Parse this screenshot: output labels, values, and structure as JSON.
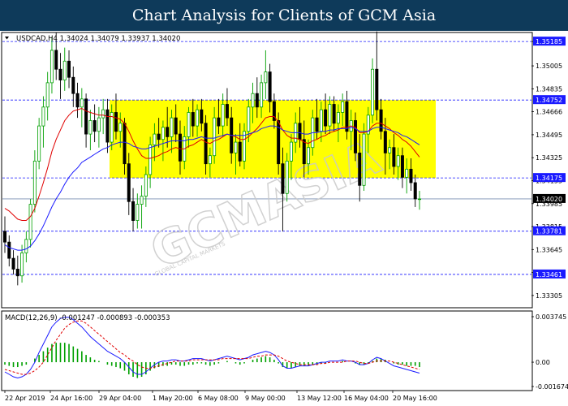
{
  "header": {
    "title": "Chart Analysis for Clients of GCM Asia"
  },
  "chart_data": {
    "type": "candlestick",
    "symbol_line": "USDCAD,H4  1.34024 1.34079 1.33937 1.34020",
    "price_ticks": [
      "1.35185",
      "1.35005",
      "1.34835",
      "1.34666",
      "1.34495",
      "1.34325",
      "1.34155",
      "1.33985",
      "1.33815",
      "1.33645",
      "1.33475",
      "1.33305"
    ],
    "marked_levels": [
      {
        "label": "1.35185",
        "value": 1.35185
      },
      {
        "label": "1.34752",
        "value": 1.34752
      },
      {
        "label": "1.34175",
        "value": 1.34175
      },
      {
        "label": "1.34020",
        "value": 1.3402
      },
      {
        "label": "1.33781",
        "value": 1.33781
      },
      {
        "label": "1.33461",
        "value": 1.33461
      }
    ],
    "range_box": {
      "top": 1.34752,
      "bottom": 1.34175,
      "color": "#ffff00"
    },
    "x_labels": [
      "22 Apr 2019",
      "24 Apr 16:00",
      "29 Apr 04:00",
      "1 May 20:00",
      "6 May 08:00",
      "9 May 00:00",
      "13 May 12:00",
      "16 May 04:00",
      "20 May 16:00"
    ],
    "candles": [
      [
        1.3378,
        1.3389,
        1.3362,
        1.337
      ],
      [
        1.337,
        1.3375,
        1.3352,
        1.3358
      ],
      [
        1.3358,
        1.3364,
        1.3346,
        1.335
      ],
      [
        1.335,
        1.336,
        1.3338,
        1.3345
      ],
      [
        1.3345,
        1.3368,
        1.334,
        1.3362
      ],
      [
        1.3362,
        1.3378,
        1.3355,
        1.3372
      ],
      [
        1.3372,
        1.3402,
        1.3366,
        1.3398
      ],
      [
        1.3398,
        1.3438,
        1.3392,
        1.343
      ],
      [
        1.343,
        1.3462,
        1.3424,
        1.3456
      ],
      [
        1.3456,
        1.3478,
        1.344,
        1.347
      ],
      [
        1.347,
        1.3496,
        1.346,
        1.3488
      ],
      [
        1.3488,
        1.3522,
        1.348,
        1.3512
      ],
      [
        1.3512,
        1.3525,
        1.349,
        1.3498
      ],
      [
        1.3498,
        1.351,
        1.3476,
        1.349
      ],
      [
        1.349,
        1.3514,
        1.3482,
        1.3504
      ],
      [
        1.3504,
        1.3512,
        1.3484,
        1.3492
      ],
      [
        1.3492,
        1.35,
        1.347,
        1.348
      ],
      [
        1.348,
        1.3488,
        1.3462,
        1.347
      ],
      [
        1.347,
        1.3484,
        1.3455,
        1.3476
      ],
      [
        1.3476,
        1.348,
        1.344,
        1.345
      ],
      [
        1.345,
        1.3468,
        1.3438,
        1.346
      ],
      [
        1.346,
        1.3472,
        1.3444,
        1.3452
      ],
      [
        1.3452,
        1.347,
        1.344,
        1.3462
      ],
      [
        1.3462,
        1.3476,
        1.345,
        1.3468
      ],
      [
        1.3468,
        1.3476,
        1.3436,
        1.3444
      ],
      [
        1.3444,
        1.3472,
        1.3438,
        1.3466
      ],
      [
        1.3466,
        1.348,
        1.3446,
        1.3452
      ],
      [
        1.3452,
        1.3466,
        1.344,
        1.3458
      ],
      [
        1.3458,
        1.3462,
        1.342,
        1.3428
      ],
      [
        1.3428,
        1.3436,
        1.339,
        1.34
      ],
      [
        1.34,
        1.341,
        1.3378,
        1.3386
      ],
      [
        1.3386,
        1.3406,
        1.338,
        1.3398
      ],
      [
        1.3398,
        1.3412,
        1.338,
        1.3404
      ],
      [
        1.3404,
        1.3426,
        1.3396,
        1.342
      ],
      [
        1.342,
        1.3448,
        1.341,
        1.3442
      ],
      [
        1.3442,
        1.3458,
        1.343,
        1.345
      ],
      [
        1.345,
        1.3462,
        1.344,
        1.3446
      ],
      [
        1.3446,
        1.346,
        1.343,
        1.3455
      ],
      [
        1.3455,
        1.347,
        1.344,
        1.3448
      ],
      [
        1.3448,
        1.3468,
        1.3436,
        1.3462
      ],
      [
        1.3462,
        1.3472,
        1.3444,
        1.345
      ],
      [
        1.345,
        1.346,
        1.342,
        1.343
      ],
      [
        1.343,
        1.3456,
        1.3424,
        1.3448
      ],
      [
        1.3448,
        1.347,
        1.344,
        1.3466
      ],
      [
        1.3466,
        1.3476,
        1.3448,
        1.3456
      ],
      [
        1.3456,
        1.3472,
        1.3448,
        1.3468
      ],
      [
        1.3468,
        1.3476,
        1.3452,
        1.3458
      ],
      [
        1.3458,
        1.3464,
        1.342,
        1.3428
      ],
      [
        1.3428,
        1.344,
        1.3418,
        1.3434
      ],
      [
        1.3434,
        1.347,
        1.3428,
        1.3462
      ],
      [
        1.3462,
        1.3476,
        1.345,
        1.3456
      ],
      [
        1.3456,
        1.348,
        1.3448,
        1.3472
      ],
      [
        1.3472,
        1.3484,
        1.3456,
        1.3462
      ],
      [
        1.3462,
        1.347,
        1.3428,
        1.3436
      ],
      [
        1.3436,
        1.345,
        1.342,
        1.3444
      ],
      [
        1.3444,
        1.3458,
        1.3426,
        1.343
      ],
      [
        1.343,
        1.3458,
        1.3424,
        1.3452
      ],
      [
        1.3452,
        1.3476,
        1.3444,
        1.347
      ],
      [
        1.347,
        1.3488,
        1.3458,
        1.348
      ],
      [
        1.348,
        1.3492,
        1.3462,
        1.347
      ],
      [
        1.347,
        1.3494,
        1.3462,
        1.3488
      ],
      [
        1.3488,
        1.3512,
        1.3476,
        1.3496
      ],
      [
        1.3496,
        1.3502,
        1.3466,
        1.3474
      ],
      [
        1.3474,
        1.348,
        1.3454,
        1.346
      ],
      [
        1.346,
        1.3466,
        1.342,
        1.3428
      ],
      [
        1.3428,
        1.344,
        1.3378,
        1.3406
      ],
      [
        1.3406,
        1.3436,
        1.34,
        1.343
      ],
      [
        1.343,
        1.345,
        1.3416,
        1.3444
      ],
      [
        1.3444,
        1.3466,
        1.3436,
        1.3458
      ],
      [
        1.3458,
        1.347,
        1.344,
        1.3446
      ],
      [
        1.3446,
        1.346,
        1.3418,
        1.3428
      ],
      [
        1.3428,
        1.3446,
        1.342,
        1.344
      ],
      [
        1.344,
        1.3468,
        1.3434,
        1.3462
      ],
      [
        1.3462,
        1.3476,
        1.3446,
        1.3452
      ],
      [
        1.3452,
        1.3474,
        1.3444,
        1.3468
      ],
      [
        1.3468,
        1.348,
        1.345,
        1.3456
      ],
      [
        1.3456,
        1.3478,
        1.345,
        1.3472
      ],
      [
        1.3472,
        1.3478,
        1.3452,
        1.3458
      ],
      [
        1.3458,
        1.3472,
        1.3444,
        1.3466
      ],
      [
        1.3466,
        1.348,
        1.3456,
        1.3474
      ],
      [
        1.3474,
        1.3482,
        1.3446,
        1.3452
      ],
      [
        1.3452,
        1.3468,
        1.3438,
        1.346
      ],
      [
        1.346,
        1.3466,
        1.343,
        1.3436
      ],
      [
        1.3436,
        1.345,
        1.34,
        1.3412
      ],
      [
        1.3412,
        1.3458,
        1.3408,
        1.345
      ],
      [
        1.345,
        1.347,
        1.3436,
        1.3464
      ],
      [
        1.3464,
        1.3506,
        1.3458,
        1.3498
      ],
      [
        1.3498,
        1.3526,
        1.346,
        1.3468
      ],
      [
        1.3468,
        1.3476,
        1.3446,
        1.3452
      ],
      [
        1.3452,
        1.3462,
        1.342,
        1.3436
      ],
      [
        1.3436,
        1.3446,
        1.3424,
        1.344
      ],
      [
        1.344,
        1.345,
        1.342,
        1.3426
      ],
      [
        1.3426,
        1.344,
        1.3416,
        1.3434
      ],
      [
        1.3434,
        1.344,
        1.341,
        1.3418
      ],
      [
        1.3418,
        1.3432,
        1.3406,
        1.3424
      ],
      [
        1.3424,
        1.3432,
        1.3408,
        1.3414
      ],
      [
        1.3414,
        1.342,
        1.3396,
        1.3402
      ],
      [
        1.3402,
        1.3408,
        1.3394,
        1.3402
      ]
    ],
    "ma_red": [
      1.3395,
      1.3393,
      1.339,
      1.3387,
      1.3386,
      1.3386,
      1.3389,
      1.3395,
      1.3404,
      1.3414,
      1.3425,
      1.3437,
      1.3446,
      1.3453,
      1.346,
      1.3464,
      1.3467,
      1.3468,
      1.3469,
      1.3467,
      1.3466,
      1.3465,
      1.3464,
      1.3464,
      1.3463,
      1.3463,
      1.3462,
      1.3461,
      1.3458,
      1.3452,
      1.3445,
      1.3439,
      1.3434,
      1.3432,
      1.3432,
      1.3433,
      1.3434,
      1.3436,
      1.3437,
      1.3439,
      1.344,
      1.3439,
      1.3439,
      1.3441,
      1.3442,
      1.3444,
      1.3446,
      1.3444,
      1.3443,
      1.3445,
      1.3446,
      1.3448,
      1.345,
      1.3449,
      1.3448,
      1.3446,
      1.3446,
      1.3448,
      1.3451,
      1.3454,
      1.3458,
      1.3462,
      1.3463,
      1.3463,
      1.3459,
      1.3453,
      1.3449,
      1.3447,
      1.3447,
      1.3446,
      1.3444,
      1.3443,
      1.3445,
      1.3446,
      1.3448,
      1.3449,
      1.3451,
      1.3452,
      1.3453,
      1.3455,
      1.3455,
      1.3456,
      1.3455,
      1.3451,
      1.3451,
      1.3452,
      1.3456,
      1.3458,
      1.3458,
      1.3456,
      1.3454,
      1.3451,
      1.3449,
      1.3446,
      1.3444,
      1.3441,
      1.3437,
      1.3433
    ],
    "ma_blue": [
      1.3368,
      1.3366,
      1.3365,
      1.3364,
      1.3364,
      1.3365,
      1.3367,
      1.3371,
      1.3376,
      1.3382,
      1.3389,
      1.3396,
      1.3402,
      1.3407,
      1.3413,
      1.3418,
      1.3422,
      1.3425,
      1.3429,
      1.3431,
      1.3433,
      1.3435,
      1.3437,
      1.3439,
      1.344,
      1.3442,
      1.3443,
      1.3444,
      1.3444,
      1.3443,
      1.3441,
      1.344,
      1.3439,
      1.3439,
      1.344,
      1.3441,
      1.3442,
      1.3443,
      1.3444,
      1.3445,
      1.3445,
      1.3445,
      1.3445,
      1.3446,
      1.3446,
      1.3447,
      1.3448,
      1.3447,
      1.3447,
      1.3447,
      1.3448,
      1.3449,
      1.345,
      1.3449,
      1.3449,
      1.3449,
      1.3449,
      1.345,
      1.3451,
      1.3452,
      1.3454,
      1.3455,
      1.3456,
      1.3456,
      1.3455,
      1.3453,
      1.3452,
      1.3451,
      1.3451,
      1.3451,
      1.345,
      1.345,
      1.3451,
      1.3451,
      1.3452,
      1.3452,
      1.3453,
      1.3453,
      1.3454,
      1.3454,
      1.3454,
      1.3455,
      1.3454,
      1.3452,
      1.3452,
      1.3452,
      1.3454,
      1.3455,
      1.3455,
      1.3454,
      1.3453,
      1.3452,
      1.3451,
      1.3449,
      1.3448,
      1.3446,
      1.3444,
      1.3442
    ],
    "macd": {
      "label": "MACD(12,26,9) -0.001247 -0.000893 -0.000353",
      "ticks": [
        "0.003745",
        "0.00",
        "-0.001674"
      ],
      "tick_values": [
        0.003745,
        0.0,
        -0.001674
      ],
      "histogram": [
        -0.0002,
        -0.0003,
        -0.0004,
        -0.0004,
        -0.0003,
        -0.0002,
        0.0,
        0.0003,
        0.0006,
        0.0009,
        0.0012,
        0.0015,
        0.0016,
        0.0016,
        0.0016,
        0.0015,
        0.0013,
        0.0011,
        0.0009,
        0.0006,
        0.0004,
        0.0002,
        0.0001,
        0.0,
        -0.0002,
        -0.0003,
        -0.0004,
        -0.0005,
        -0.0007,
        -0.001,
        -0.0012,
        -0.0013,
        -0.0012,
        -0.001,
        -0.0007,
        -0.0005,
        -0.0004,
        -0.0003,
        -0.0003,
        -0.0002,
        -0.0002,
        -0.0003,
        -0.0003,
        -0.0002,
        -0.0002,
        -0.0001,
        -0.0001,
        -0.0002,
        -0.0003,
        -0.0002,
        -0.0001,
        0.0,
        0.0001,
        0.0,
        -0.0001,
        -0.0002,
        -0.0001,
        0.0,
        0.0002,
        0.0003,
        0.0004,
        0.0005,
        0.0004,
        0.0002,
        -0.0001,
        -0.0004,
        -0.0005,
        -0.0005,
        -0.0004,
        -0.0003,
        -0.0003,
        -0.0003,
        -0.0002,
        -0.0002,
        -0.0001,
        -0.0001,
        0.0,
        0.0,
        0.0,
        0.0001,
        0.0,
        0.0,
        -0.0001,
        -0.0002,
        -0.0002,
        -0.0001,
        0.0001,
        0.0003,
        0.0003,
        0.0002,
        0.0,
        -0.0001,
        -0.0002,
        -0.0002,
        -0.0003,
        -0.0003,
        -0.0003,
        -0.0004
      ],
      "macd_line": [
        -0.0008,
        -0.001,
        -0.0012,
        -0.0013,
        -0.0012,
        -0.001,
        -0.0006,
        0.0,
        0.0008,
        0.0015,
        0.0022,
        0.0029,
        0.0033,
        0.0036,
        0.0037,
        0.0037,
        0.0035,
        0.0032,
        0.0029,
        0.0025,
        0.0021,
        0.0018,
        0.0015,
        0.0012,
        0.0009,
        0.0007,
        0.0005,
        0.0003,
        0.0,
        -0.0004,
        -0.0008,
        -0.001,
        -0.001,
        -0.0008,
        -0.0005,
        -0.0002,
        0.0,
        0.0001,
        0.0001,
        0.0002,
        0.0002,
        0.0001,
        0.0001,
        0.0002,
        0.0003,
        0.0003,
        0.0003,
        0.0002,
        0.0001,
        0.0002,
        0.0003,
        0.0004,
        0.0005,
        0.0004,
        0.0003,
        0.0002,
        0.0003,
        0.0004,
        0.0006,
        0.0007,
        0.0008,
        0.0009,
        0.0008,
        0.0006,
        0.0002,
        -0.0003,
        -0.0005,
        -0.0005,
        -0.0004,
        -0.0003,
        -0.0003,
        -0.0003,
        -0.0002,
        -0.0001,
        0.0,
        0.0,
        0.0001,
        0.0001,
        0.0001,
        0.0002,
        0.0001,
        0.0001,
        0.0,
        -0.0002,
        -0.0002,
        -0.0001,
        0.0002,
        0.0004,
        0.0003,
        0.0001,
        -0.0001,
        -0.0003,
        -0.0004,
        -0.0005,
        -0.0006,
        -0.0007,
        -0.0008,
        -0.0009
      ],
      "signal_line": [
        -0.0006,
        -0.0007,
        -0.0008,
        -0.0009,
        -0.001,
        -0.001,
        -0.0009,
        -0.0007,
        -0.0004,
        0.0,
        0.0006,
        0.0012,
        0.0018,
        0.0023,
        0.0028,
        0.0031,
        0.0033,
        0.0034,
        0.0034,
        0.0032,
        0.0029,
        0.0026,
        0.0023,
        0.002,
        0.0017,
        0.0014,
        0.0011,
        0.0008,
        0.0006,
        0.0003,
        0.0001,
        -0.0002,
        -0.0004,
        -0.0005,
        -0.0005,
        -0.0004,
        -0.0003,
        -0.0002,
        -0.0001,
        0.0,
        0.0001,
        0.0001,
        0.0001,
        0.0001,
        0.0002,
        0.0002,
        0.0002,
        0.0002,
        0.0002,
        0.0002,
        0.0002,
        0.0003,
        0.0003,
        0.0003,
        0.0003,
        0.0003,
        0.0003,
        0.0003,
        0.0004,
        0.0005,
        0.0005,
        0.0006,
        0.0006,
        0.0006,
        0.0005,
        0.0003,
        0.0001,
        0.0,
        -0.0001,
        -0.0002,
        -0.0002,
        -0.0002,
        -0.0002,
        -0.0002,
        -0.0001,
        -0.0001,
        0.0,
        0.0,
        0.0,
        0.0,
        0.0001,
        0.0001,
        0.0001,
        0.0,
        -0.0001,
        -0.0001,
        0.0,
        0.0001,
        0.0001,
        0.0001,
        0.0001,
        0.0,
        -0.0001,
        -0.0002,
        -0.0003,
        -0.0004,
        -0.0005,
        -0.0006
      ]
    }
  },
  "watermark": {
    "text": "GCMASIA",
    "tagline": "GLOBAL CAPITAL MARKETS"
  }
}
